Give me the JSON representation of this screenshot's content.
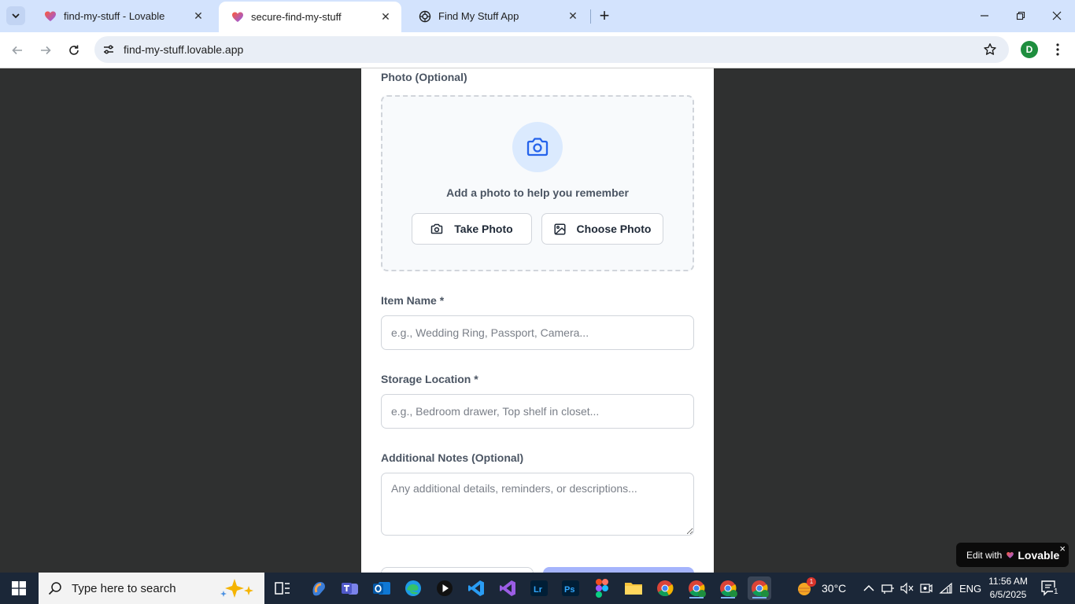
{
  "browser": {
    "tabs": [
      {
        "title": "find-my-stuff - Lovable",
        "active": false
      },
      {
        "title": "secure-find-my-stuff",
        "active": true
      },
      {
        "title": "Find My Stuff App",
        "active": false
      }
    ],
    "url": "find-my-stuff.lovable.app",
    "profile_initial": "D"
  },
  "form": {
    "photo_label": "Photo (Optional)",
    "upload_hint": "Add a photo to help you remember",
    "take_photo": "Take Photo",
    "choose_photo": "Choose Photo",
    "item_name_label": "Item Name *",
    "item_name_placeholder": "e.g., Wedding Ring, Passport, Camera...",
    "storage_label": "Storage Location *",
    "storage_placeholder": "e.g., Bedroom drawer, Top shelf in closet...",
    "notes_label": "Additional Notes (Optional)",
    "notes_placeholder": "Any additional details, reminders, or descriptions..."
  },
  "lovable_badge": {
    "prefix": "Edit with",
    "brand": "Lovable",
    "close": "×"
  },
  "taskbar": {
    "search_placeholder": "Type here to search",
    "weather": "30°C",
    "weather_badge": "1",
    "language": "ENG",
    "time": "11:56 AM",
    "date": "6/5/2025",
    "notifications": "1"
  },
  "colors": {
    "accent": "#2563eb",
    "tabstrip": "#d3e3fd",
    "page_bg": "#2f3030",
    "taskbar": "#1b2738"
  }
}
